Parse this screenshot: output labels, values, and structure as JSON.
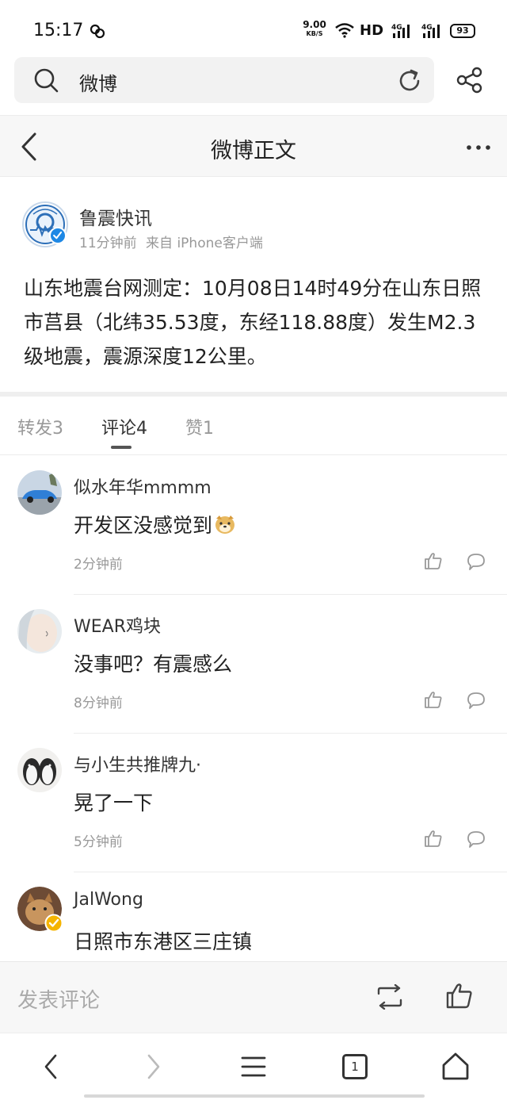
{
  "status_bar": {
    "time": "15:17",
    "net_speed": "9.00",
    "net_speed_unit": "KB/S",
    "hd_label": "HD",
    "signal_1": "4G",
    "signal_2": "4G",
    "battery": "93"
  },
  "browser": {
    "address_text": "微博"
  },
  "header": {
    "title": "微博正文"
  },
  "post": {
    "author": "鲁震快讯",
    "time": "11分钟前",
    "source": "来自 iPhone客户端",
    "content": "山东地震台网测定：10月08日14时49分在山东日照市莒县（北纬35.53度，东经118.88度）发生M2.3级地震，震源深度12公里。"
  },
  "tabs": [
    {
      "label": "转发3"
    },
    {
      "label": "评论4"
    },
    {
      "label": "赞1"
    }
  ],
  "comments": [
    {
      "name": "似水年华mmmm",
      "text": "开发区没感觉到",
      "time": "2分钟前"
    },
    {
      "name": "WEAR鸡块",
      "text": "没事吧？有震感么",
      "time": "8分钟前"
    },
    {
      "name": "与小生共推牌九·",
      "text": "晃了一下",
      "time": "5分钟前"
    },
    {
      "name": "JalWong",
      "text": "日照市东港区三庄镇",
      "time": ""
    }
  ],
  "comment_bar": {
    "placeholder": "发表评论"
  },
  "nav": {
    "tab_count": "1"
  },
  "colors": {
    "accent_blue": "#1e88e5",
    "verified_gold": "#f5b400",
    "muted_text": "#999999"
  }
}
